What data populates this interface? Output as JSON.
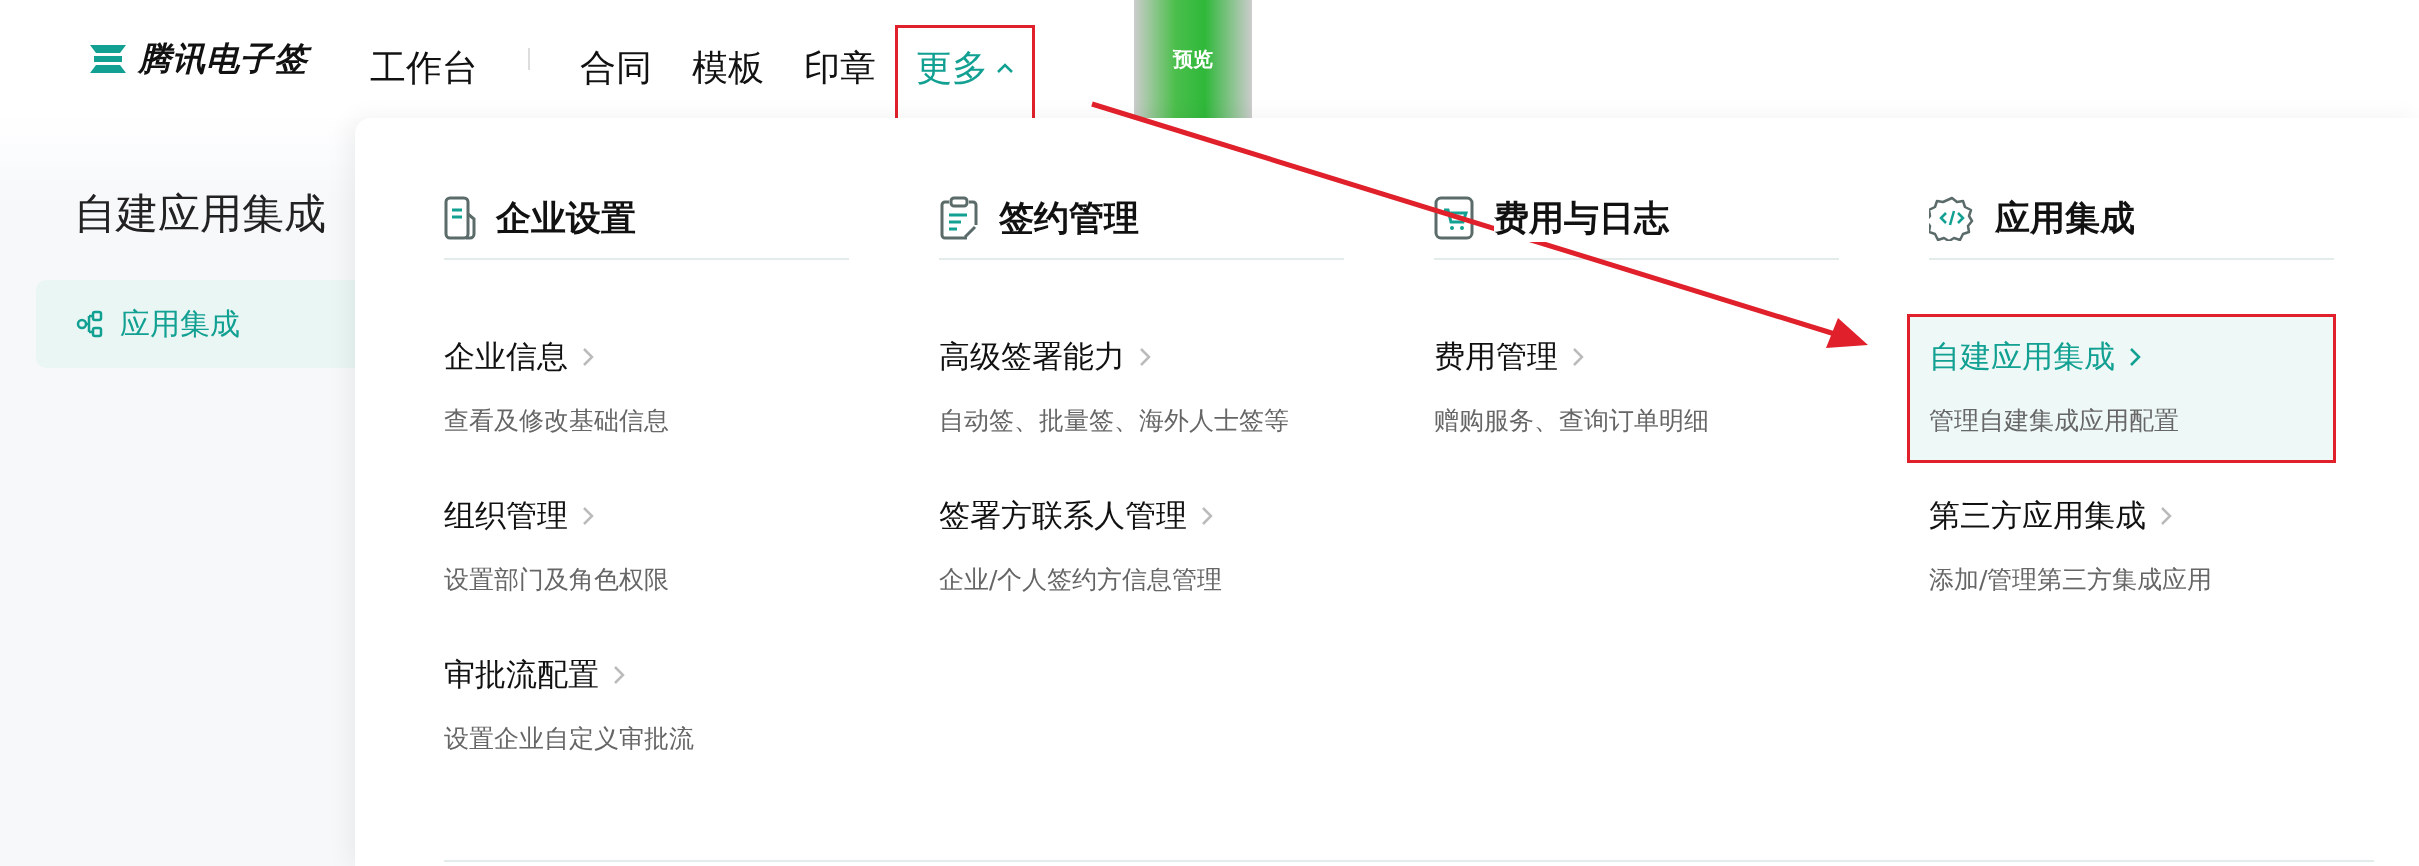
{
  "logo": {
    "text": "腾讯电子签"
  },
  "nav": [
    {
      "label": "工作台",
      "selected": false,
      "highlighted": false
    },
    {
      "label": "合同",
      "selected": false,
      "highlighted": false
    },
    {
      "label": "模板",
      "selected": false,
      "highlighted": false
    },
    {
      "label": "印章",
      "selected": false,
      "highlighted": false
    },
    {
      "label": "更多",
      "selected": true,
      "highlighted": true,
      "expanded": true
    }
  ],
  "preview_badge": "预览",
  "sidebar": {
    "title": "自建应用集成",
    "items": [
      {
        "label": "应用集成",
        "selected": true
      }
    ]
  },
  "menu_sections": [
    {
      "kind": "company",
      "title": "企业设置",
      "items": [
        {
          "title": "企业信息",
          "description": "查看及修改基础信息",
          "selected": false,
          "highlighted": false
        },
        {
          "title": "组织管理",
          "description": "设置部门及角色权限",
          "selected": false,
          "highlighted": false
        },
        {
          "title": "审批流配置",
          "description": "设置企业自定义审批流",
          "selected": false,
          "highlighted": false
        }
      ]
    },
    {
      "kind": "signing",
      "title": "签约管理",
      "items": [
        {
          "title": "高级签署能力",
          "description": "自动签、批量签、海外人士签等",
          "selected": false,
          "highlighted": false
        },
        {
          "title": "签署方联系人管理",
          "description": "企业/个人签约方信息管理",
          "selected": false,
          "highlighted": false
        }
      ]
    },
    {
      "kind": "billing",
      "title": "费用与日志",
      "items": [
        {
          "title": "费用管理",
          "description": "赠购服务、查询订单明细",
          "selected": false,
          "highlighted": false
        }
      ]
    },
    {
      "kind": "integration",
      "title": "应用集成",
      "items": [
        {
          "title": "自建应用集成",
          "description": "管理自建集成应用配置",
          "selected": true,
          "highlighted": true
        },
        {
          "title": "第三方应用集成",
          "description": "添加/管理第三方集成应用",
          "selected": false,
          "highlighted": false
        }
      ]
    }
  ],
  "annotation": {
    "arrow": true
  }
}
